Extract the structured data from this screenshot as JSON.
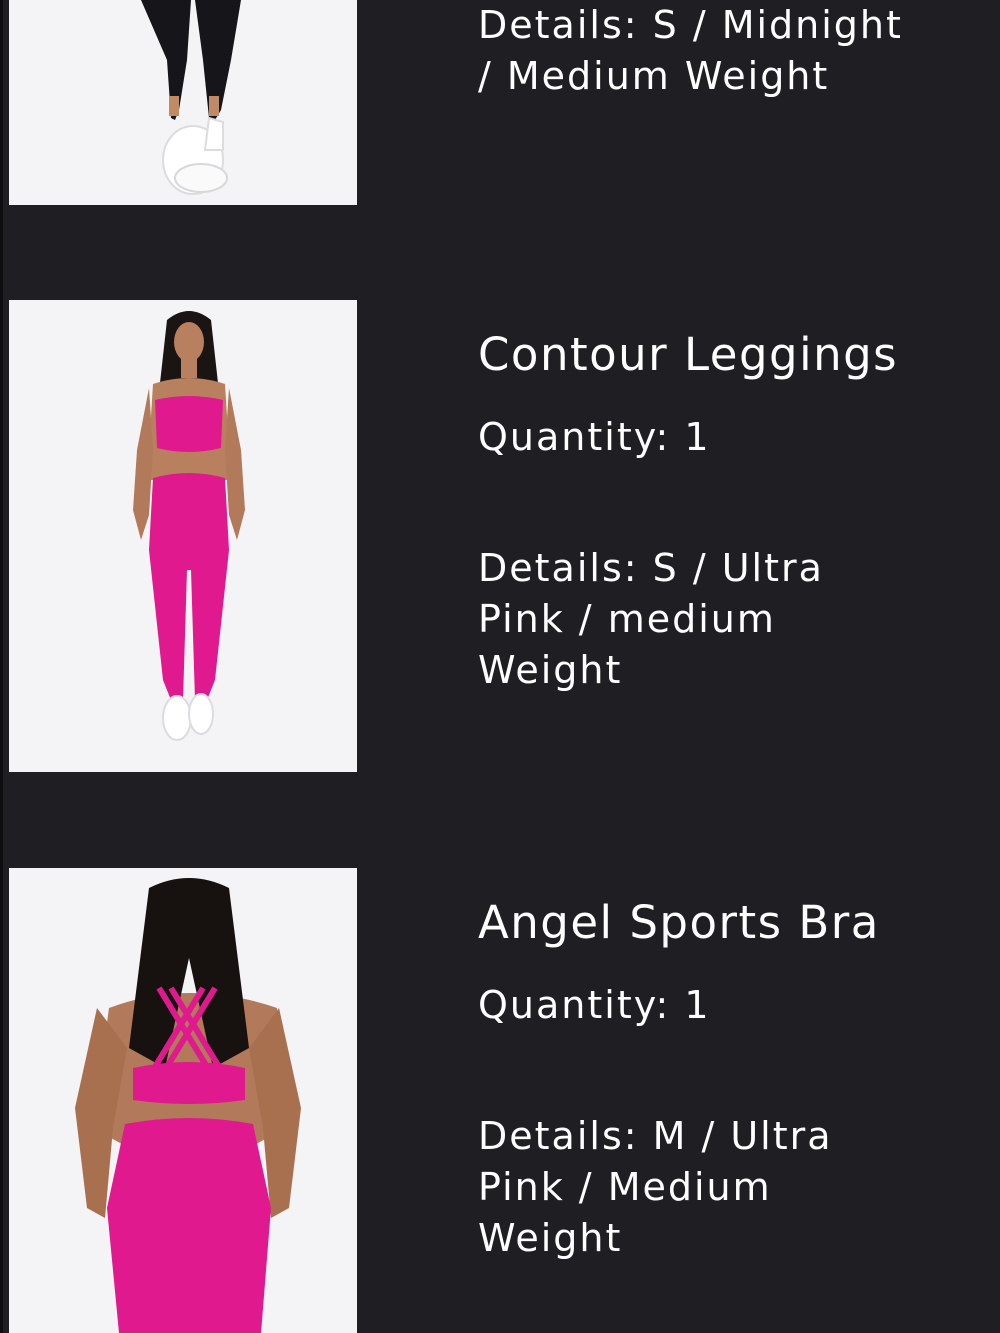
{
  "colors": {
    "background": "#1f1f23",
    "text": "#ffffff",
    "product_pink": "#e0198f",
    "legging_black": "#15151a"
  },
  "items": [
    {
      "image_icon": "product-photo-black-leggings",
      "name": "",
      "quantity": "",
      "details": "Details: S / Midnight / Medium Weight"
    },
    {
      "image_icon": "product-photo-pink-set-front",
      "name": "Contour Leggings",
      "quantity": "Quantity: 1",
      "details": "Details: S / Ultra Pink / medium Weight"
    },
    {
      "image_icon": "product-photo-pink-set-back",
      "name": "Angel Sports Bra",
      "quantity": "Quantity: 1",
      "details": "Details: M / Ultra Pink / Medium Weight"
    }
  ]
}
